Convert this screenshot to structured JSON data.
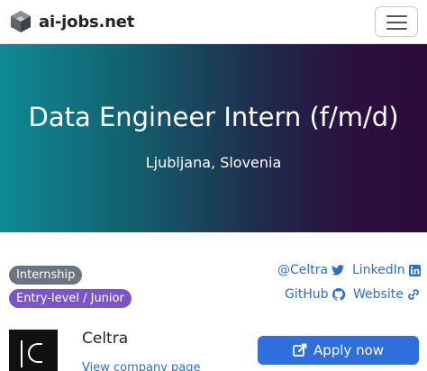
{
  "navbar": {
    "brand": "ai-jobs.net",
    "logo_icon": "ai-jobs-logo-icon",
    "menu_icon": "hamburger-menu-icon"
  },
  "hero": {
    "title": "Data Engineer Intern (f/m/d)",
    "location": "Ljubljana, Slovenia"
  },
  "badges": {
    "type": "Internship",
    "level": "Entry-level / Junior"
  },
  "social": {
    "twitter": "@Celtra",
    "linkedin": "LinkedIn",
    "github": "GitHub",
    "website": "Website"
  },
  "company": {
    "name": "Celtra",
    "link": "View company page"
  },
  "apply": {
    "label": "Apply now"
  },
  "colors": {
    "link": "#2d6fd1",
    "apply_button": "#2f6fdd",
    "badge_gray": "#6c757d",
    "badge_purple": "#7b55c7",
    "hero_gradient_start": "#0e8a95",
    "hero_gradient_end": "#2c0b38"
  }
}
